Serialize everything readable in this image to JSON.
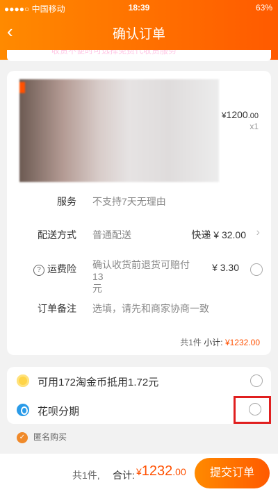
{
  "status_bar": {
    "carrier": "●●●●○ 中国移动",
    "time": "18:39",
    "battery": "63%"
  },
  "header": {
    "title": "确认订单",
    "back_icon": "chevron-left-icon"
  },
  "top_strip": {
    "text": "收货不便时可选择免费代收货服务"
  },
  "product": {
    "price_symbol": "¥",
    "price_int": "1200",
    "price_dec": ".00",
    "quantity": "x1"
  },
  "details": {
    "service_label": "服务",
    "service_value": "不支持7天无理由",
    "delivery_label": "配送方式",
    "delivery_value": "普通配送",
    "shipping_fee": "快递 ¥ 32.00",
    "insurance_label": "运费险",
    "insurance_desc_line1": "确认收货前退货可赔付13",
    "insurance_desc_line2": "元",
    "insurance_fee": "¥ 3.30",
    "note_label": "订单备注",
    "note_placeholder": "选填，请先和商家协商一致",
    "subtotal_count": "共1件",
    "subtotal_label": "小计:",
    "subtotal_amount": "¥1232.00"
  },
  "options": {
    "coin_text": "可用172淘金币抵用1.72元",
    "huabei_text": "花呗分期"
  },
  "anonymous": {
    "text": "匿名购买"
  },
  "footer": {
    "count": "共1件,",
    "total_label": "合计:",
    "total_symbol": "¥",
    "total_int": "1232",
    "total_dec": ".00",
    "submit_label": "提交订单"
  },
  "colors": {
    "accent": "#ff5000",
    "highlight_box": "#e01f1f"
  }
}
